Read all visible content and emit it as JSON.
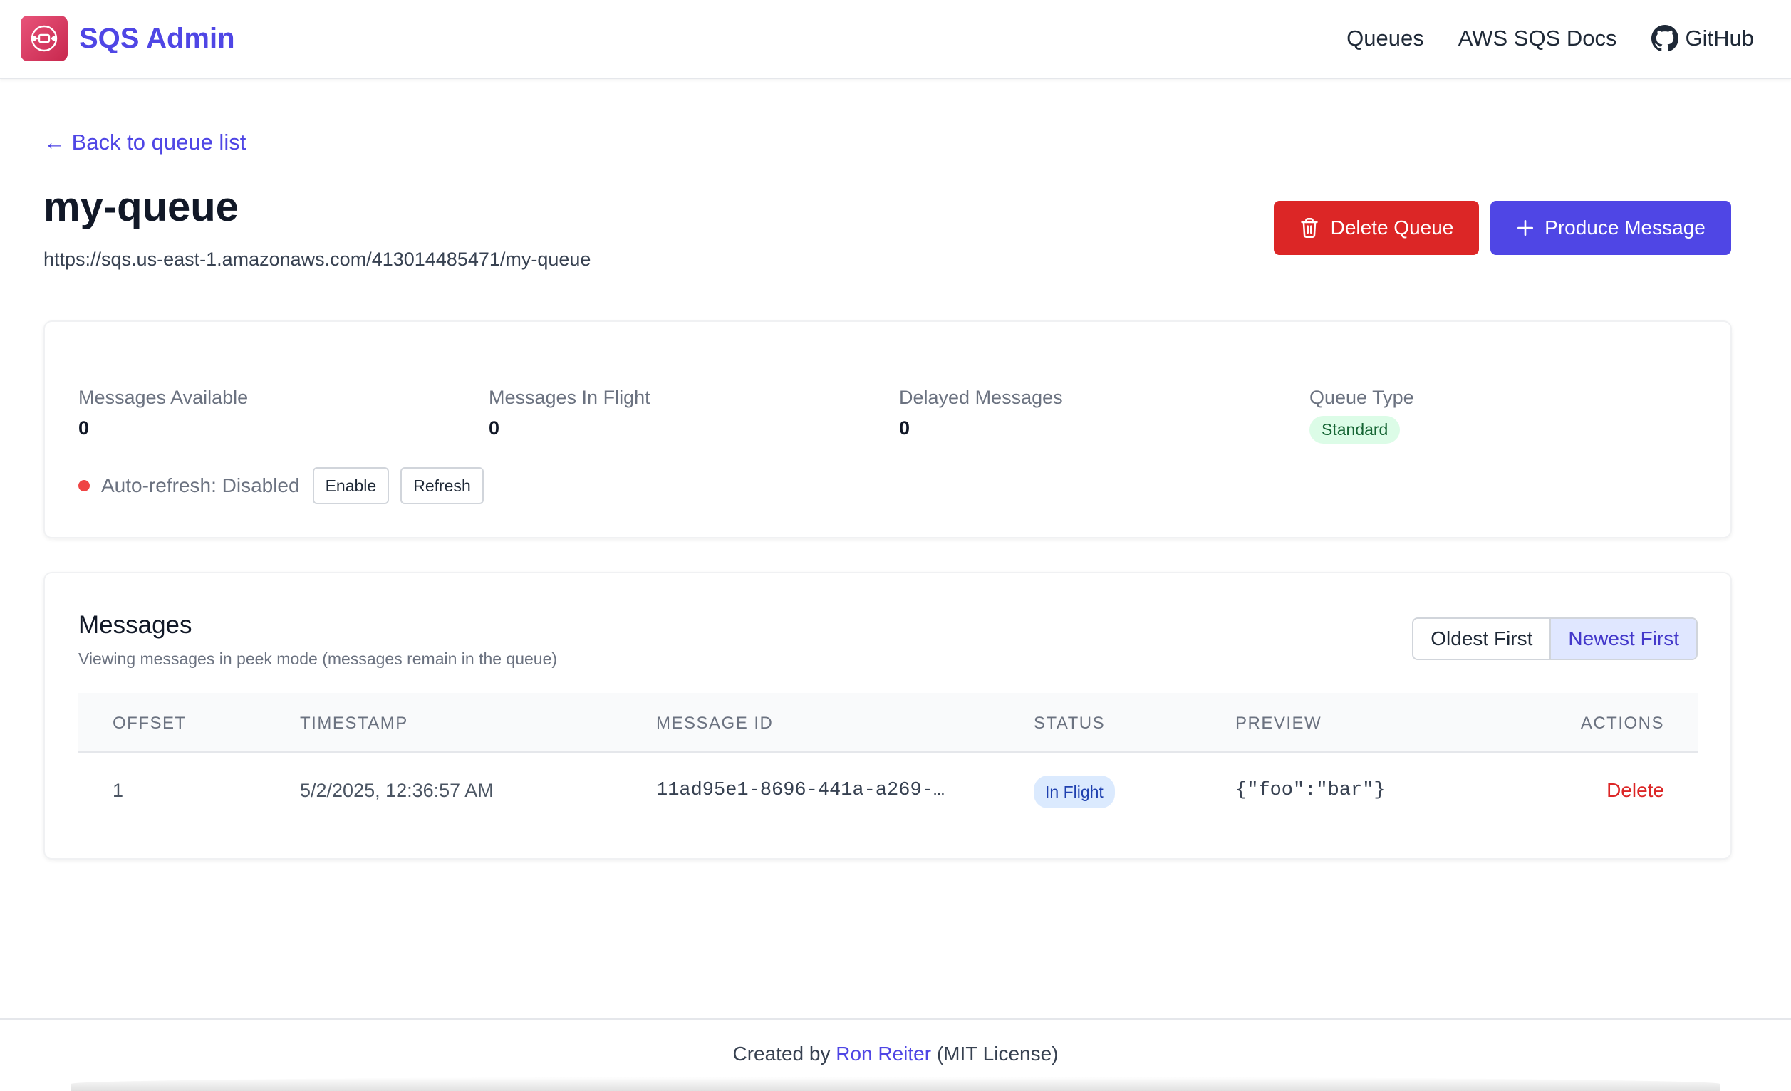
{
  "header": {
    "brand": "SQS Admin",
    "nav": [
      {
        "label": "Queues"
      },
      {
        "label": "AWS SQS Docs"
      },
      {
        "label": "GitHub",
        "icon": "github-icon"
      }
    ]
  },
  "back_link": "← Back to queue list",
  "queue": {
    "name": "my-queue",
    "url": "https://sqs.us-east-1.amazonaws.com/413014485471/my-queue"
  },
  "actions": {
    "delete_label": "Delete Queue",
    "produce_label": "Produce Message"
  },
  "stats": {
    "available_label": "Messages Available",
    "available_value": "0",
    "inflight_label": "Messages In Flight",
    "inflight_value": "0",
    "delayed_label": "Delayed Messages",
    "delayed_value": "0",
    "type_label": "Queue Type",
    "type_value": "Standard"
  },
  "autorefresh": {
    "text": "Auto-refresh: Disabled",
    "enable_label": "Enable",
    "refresh_label": "Refresh"
  },
  "messages": {
    "title": "Messages",
    "subtitle": "Viewing messages in peek mode (messages remain in the queue)",
    "sort": {
      "oldest": "Oldest First",
      "newest": "Newest First",
      "selected": "Newest First"
    },
    "columns": [
      "OFFSET",
      "TIMESTAMP",
      "MESSAGE ID",
      "STATUS",
      "PREVIEW",
      "ACTIONS"
    ],
    "rows": [
      {
        "offset": "1",
        "timestamp": "5/2/2025, 12:36:57 AM",
        "message_id": "11ad95e1-8696-441a-a269-…",
        "status": "In Flight",
        "preview": "{\"foo\":\"bar\"}",
        "action": "Delete"
      }
    ]
  },
  "footer": {
    "prefix": "Created by ",
    "author": "Ron Reiter",
    "suffix": " (MIT License)"
  },
  "colors": {
    "primary": "#4f46e5",
    "danger": "#dc2626",
    "success_bg": "#dcfce7",
    "info_bg": "#dbeafe"
  }
}
